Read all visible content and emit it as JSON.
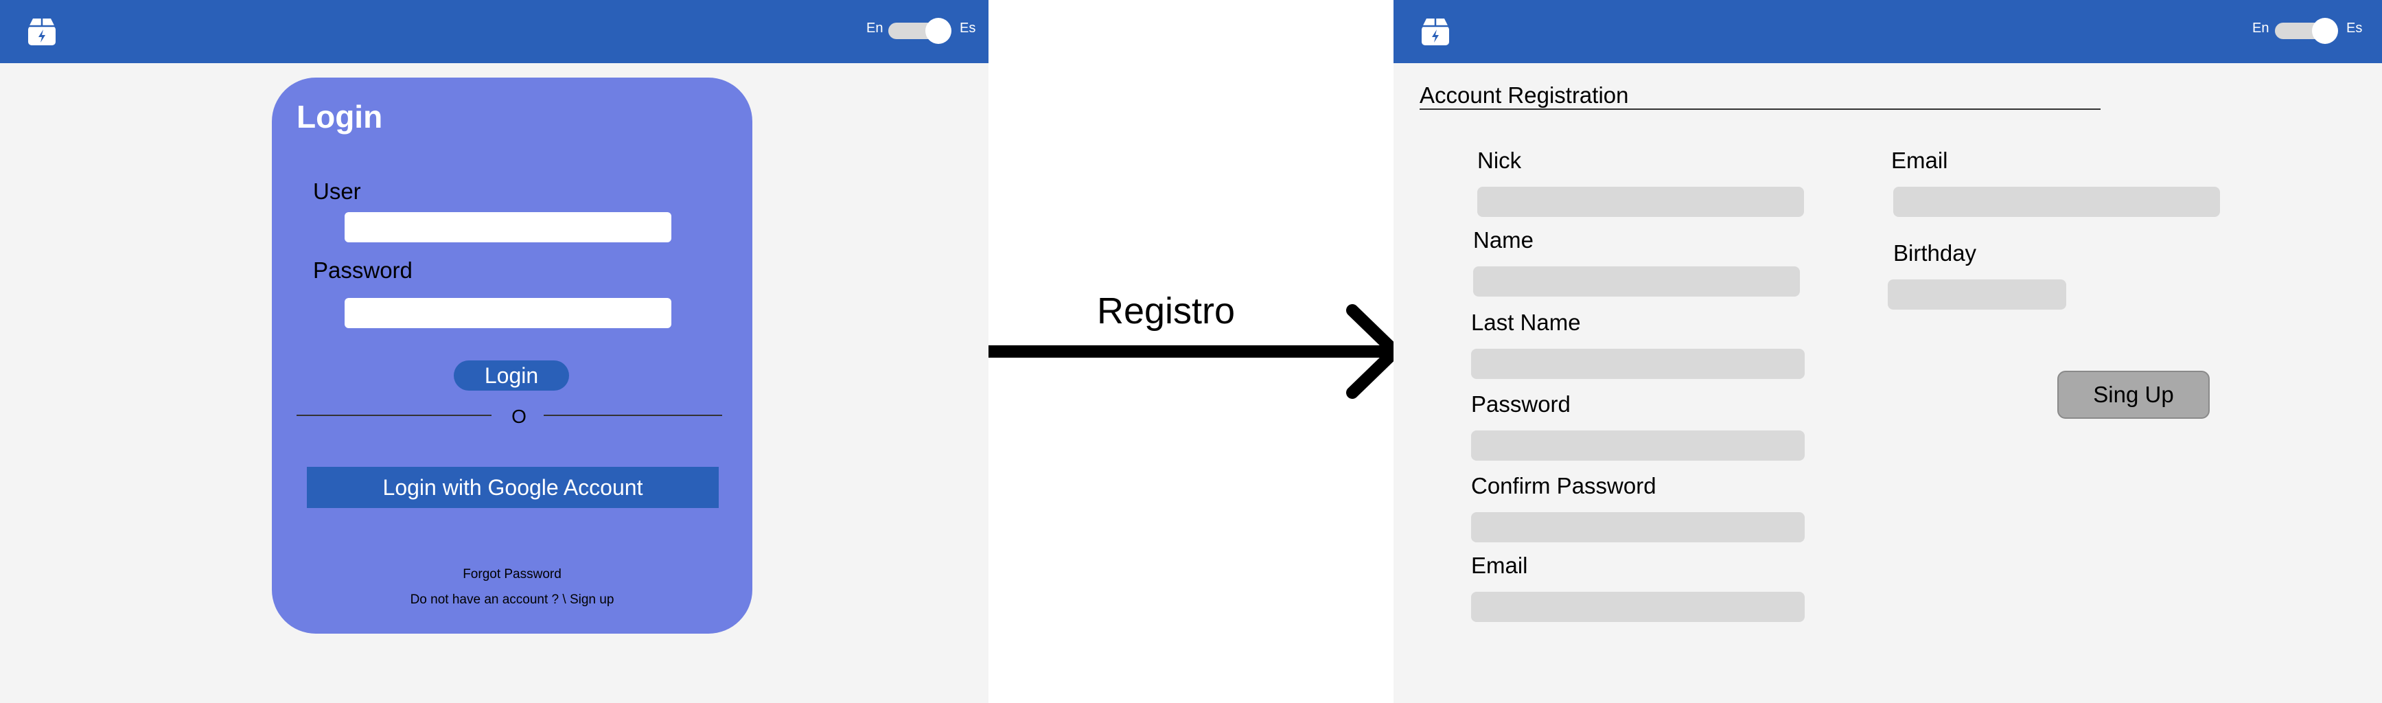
{
  "colors": {
    "header": "#2a60b8",
    "panel_background": "#f4f4f4",
    "login_card": "#6f7fe3",
    "primary_button": "#2a60b8",
    "registration_input": "#d9d9d9",
    "signup_button": "#a9a9a9"
  },
  "login_screen": {
    "header": {
      "logo_icon": "box-lightning-icon",
      "lang_left": "En",
      "lang_right": "Es"
    },
    "title": "Login",
    "user_label": "User",
    "user_value": "",
    "password_label": "Password",
    "password_value": "",
    "login_button": "Login",
    "separator": "O",
    "google_button": "Login with Google Account",
    "forgot_password": "Forgot Password",
    "signup_prompt": "Do not have an account ? \\ Sign up"
  },
  "transition": {
    "label": "Registro",
    "icon": "arrow-right-icon"
  },
  "registration_screen": {
    "header": {
      "logo_icon": "box-lightning-icon",
      "lang_left": "En",
      "lang_right": "Es"
    },
    "title": "Account Registration",
    "fields": {
      "nick": "Nick",
      "name": "Name",
      "last_name": "Last Name",
      "password": "Password",
      "confirm_password": "Confirm Password",
      "email_left": "Email",
      "email_right": "Email",
      "birthday": "Birthday"
    },
    "signup_button": "Sing Up"
  }
}
